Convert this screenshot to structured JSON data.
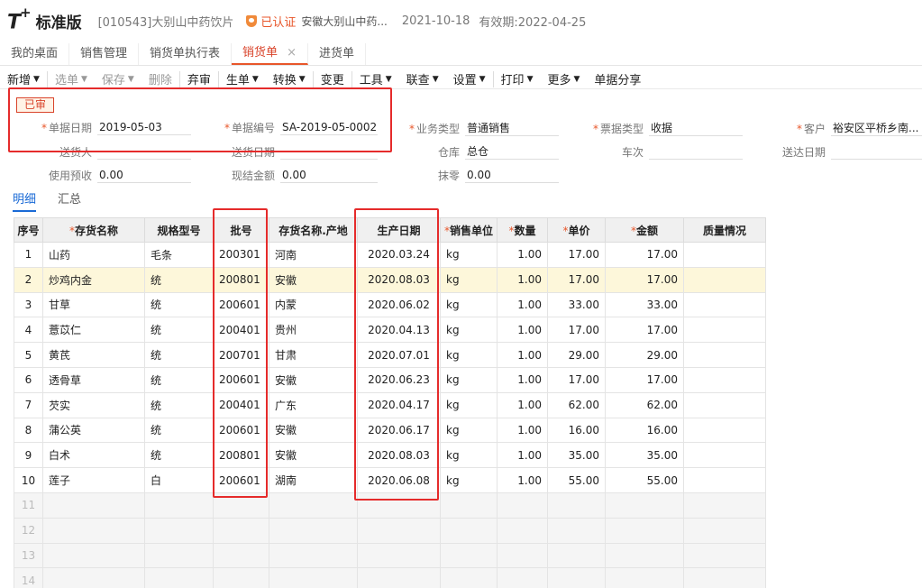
{
  "header": {
    "logo": "T",
    "logo_plus": "+",
    "edition": "标准版",
    "company": "[010543]大别山中药饮片",
    "certified": "已认证",
    "certified_company": "安徽大别山中药...",
    "date": "2021-10-18",
    "valid": "有效期:2022-04-25"
  },
  "tabs": [
    "我的桌面",
    "销售管理",
    "销货单执行表",
    "销货单",
    "进货单"
  ],
  "active_tab_close": "×",
  "toolbar": [
    {
      "label": "新增",
      "caret": true
    },
    {
      "label": "选单",
      "caret": true,
      "disabled": true
    },
    {
      "label": "保存",
      "caret": true,
      "disabled": true
    },
    {
      "label": "删除",
      "disabled": true
    },
    {
      "label": "弃审"
    },
    {
      "label": "生单",
      "caret": true
    },
    {
      "label": "转换",
      "caret": true
    },
    {
      "label": "变更"
    },
    {
      "label": "工具",
      "caret": true
    },
    {
      "label": "联查",
      "caret": true
    },
    {
      "label": "设置",
      "caret": true
    },
    {
      "label": "打印",
      "caret": true
    },
    {
      "label": "更多",
      "caret": true
    },
    {
      "label": "单据分享"
    }
  ],
  "status": "已审",
  "form": {
    "doc_date": {
      "label": "单据日期",
      "value": "2019-05-03"
    },
    "doc_no": {
      "label": "单据编号",
      "value": "SA-2019-05-0002"
    },
    "biz_type": {
      "label": "业务类型",
      "value": "普通销售"
    },
    "invoice_type": {
      "label": "票据类型",
      "value": "收据"
    },
    "customer": {
      "label": "客户",
      "value": "裕安区平桥乡南..."
    },
    "deliverer": {
      "label": "送货人",
      "value": ""
    },
    "delivery_date": {
      "label": "送货日期",
      "value": ""
    },
    "warehouse": {
      "label": "仓库",
      "value": "总仓"
    },
    "trip": {
      "label": "车次",
      "value": ""
    },
    "arrival_date": {
      "label": "送达日期",
      "value": ""
    },
    "prepay": {
      "label": "使用预收",
      "value": "0.00"
    },
    "cash": {
      "label": "现结金额",
      "value": "0.00"
    },
    "discount": {
      "label": "抹零",
      "value": "0.00"
    }
  },
  "subtabs": [
    "明细",
    "汇总"
  ],
  "table": {
    "headers": [
      "序号",
      "存货名称",
      "规格型号",
      "批号",
      "存货名称.产地",
      "生产日期",
      "销售单位",
      "数量",
      "单价",
      "金额",
      "质量情况"
    ],
    "required_columns": [
      1,
      6,
      7,
      8,
      9
    ],
    "rows": [
      [
        "1",
        "山药",
        "毛条",
        "200301",
        "河南",
        "2020.03.24",
        "kg",
        "1.00",
        "17.00",
        "17.00",
        ""
      ],
      [
        "2",
        "炒鸡内金",
        "统",
        "200801",
        "安徽",
        "2020.08.03",
        "kg",
        "1.00",
        "17.00",
        "17.00",
        ""
      ],
      [
        "3",
        "甘草",
        "统",
        "200601",
        "内蒙",
        "2020.06.02",
        "kg",
        "1.00",
        "33.00",
        "33.00",
        ""
      ],
      [
        "4",
        "薏苡仁",
        "统",
        "200401",
        "贵州",
        "2020.04.13",
        "kg",
        "1.00",
        "17.00",
        "17.00",
        ""
      ],
      [
        "5",
        "黄芪",
        "统",
        "200701",
        "甘肃",
        "2020.07.01",
        "kg",
        "1.00",
        "29.00",
        "29.00",
        ""
      ],
      [
        "6",
        "透骨草",
        "统",
        "200601",
        "安徽",
        "2020.06.23",
        "kg",
        "1.00",
        "17.00",
        "17.00",
        ""
      ],
      [
        "7",
        "芡实",
        "统",
        "200401",
        "广东",
        "2020.04.17",
        "kg",
        "1.00",
        "62.00",
        "62.00",
        ""
      ],
      [
        "8",
        "蒲公英",
        "统",
        "200601",
        "安徽",
        "2020.06.17",
        "kg",
        "1.00",
        "16.00",
        "16.00",
        ""
      ],
      [
        "9",
        "白术",
        "统",
        "200801",
        "安徽",
        "2020.08.03",
        "kg",
        "1.00",
        "35.00",
        "35.00",
        ""
      ],
      [
        "10",
        "莲子",
        "白",
        "200601",
        "湖南",
        "2020.06.08",
        "kg",
        "1.00",
        "55.00",
        "55.00",
        ""
      ]
    ],
    "empty_rows": [
      "11",
      "12",
      "13",
      "14"
    ],
    "selected_row": 1
  }
}
